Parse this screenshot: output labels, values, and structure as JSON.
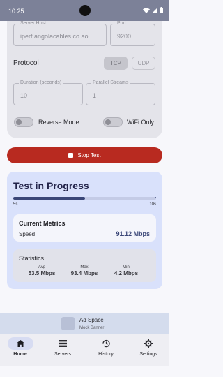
{
  "status_bar": {
    "time": "10:25"
  },
  "config": {
    "server_host": {
      "label": "Server Host",
      "value": "iperf.angolacables.co.ao"
    },
    "port": {
      "label": "Port",
      "value": "9200"
    },
    "protocol": {
      "label": "Protocol",
      "options": [
        "TCP",
        "UDP"
      ],
      "selected": "TCP"
    },
    "duration": {
      "label": "Duration (seconds)",
      "value": "10"
    },
    "parallel_streams": {
      "label": "Parallel Streams",
      "value": "1"
    },
    "reverse_mode": {
      "label": "Reverse Mode",
      "on": false
    },
    "wifi_only": {
      "label": "WiFi Only",
      "on": false
    }
  },
  "stop_button": {
    "label": "Stop Test"
  },
  "progress": {
    "title": "Test in Progress",
    "fraction": 0.5,
    "elapsed_label": "5s",
    "total_label": "10s",
    "current_metrics": {
      "title": "Current Metrics",
      "label": "Speed",
      "value": "91.12 Mbps"
    },
    "statistics": {
      "title": "Statistics",
      "items": [
        {
          "label": "Avg",
          "value": "53.5 Mbps"
        },
        {
          "label": "Max",
          "value": "93.4 Mbps"
        },
        {
          "label": "Min",
          "value": "4.2 Mbps"
        }
      ]
    }
  },
  "ad": {
    "title": "Ad Space",
    "subtitle": "Mock Banner"
  },
  "nav": {
    "items": [
      {
        "label": "Home",
        "icon": "home-icon",
        "active": true
      },
      {
        "label": "Servers",
        "icon": "servers-icon",
        "active": false
      },
      {
        "label": "History",
        "icon": "history-icon",
        "active": false
      },
      {
        "label": "Settings",
        "icon": "gear-icon",
        "active": false
      }
    ]
  },
  "colors": {
    "accent": "#3a4677",
    "stop": "#b82a20",
    "card": "#d9e1fb"
  }
}
